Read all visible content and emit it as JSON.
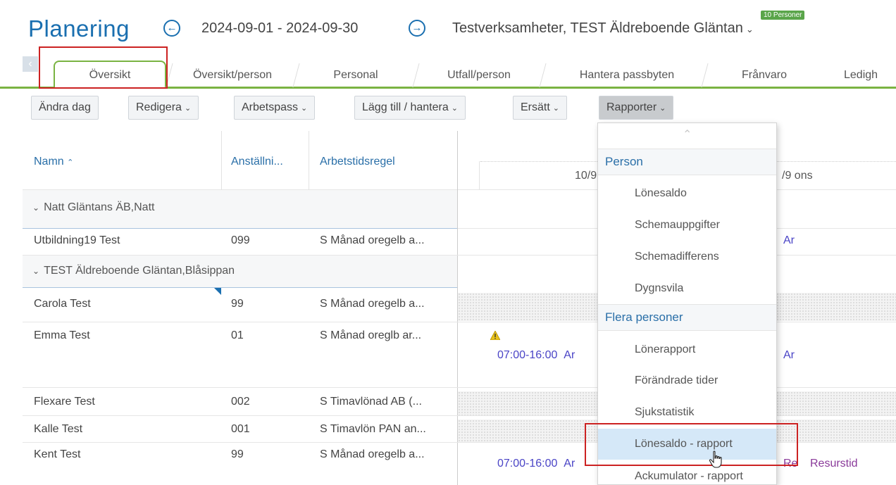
{
  "header": {
    "title": "Planering",
    "period": "2024-09-01 - 2024-09-30",
    "organization": "Testverksamheter, TEST Äldreboende Gläntan",
    "persons_badge": "10 Personer",
    "prev_icon": "circle-arrow-left-icon",
    "next_icon": "circle-arrow-right-icon"
  },
  "tabs": [
    {
      "label": "Översikt",
      "active": true
    },
    {
      "label": "Översikt/person"
    },
    {
      "label": "Personal"
    },
    {
      "label": "Utfall/person"
    },
    {
      "label": "Hantera passbyten"
    },
    {
      "label": "Frånvaro"
    },
    {
      "label": "Ledigh"
    }
  ],
  "toolbar": {
    "change_day": "Ändra dag",
    "edit": "Redigera",
    "shifts": "Arbetspass",
    "add_manage": "Lägg till / hantera",
    "replace": "Ersätt",
    "reports": "Rapporter"
  },
  "columns": {
    "name": "Namn",
    "name_sort": "^",
    "employment": "Anställni...",
    "rule": "Arbetstidsregel",
    "day1": "10/9 t",
    "day2": "/9 ons"
  },
  "groups": [
    {
      "label": "Natt Gläntans ÄB,Natt"
    },
    {
      "label": "TEST Äldreboende Gläntan,Blåsippan"
    }
  ],
  "rows": [
    {
      "name": "Utbildning19 Test",
      "emp": "099",
      "rule": "S Månad oregelb a...",
      "day2": "Ar"
    },
    {
      "name": "Carola Test",
      "emp": "99",
      "rule": "S Månad oregelb a..."
    },
    {
      "name": "Emma Test",
      "emp": "01",
      "rule": "S Månad oreglb ar...",
      "shift": "07:00-16:00",
      "shift_code": "Ar",
      "day2": "Ar"
    },
    {
      "name": "Flexare Test",
      "emp": "002",
      "rule": "S Timavlönad AB (..."
    },
    {
      "name": "Kalle Test",
      "emp": "001",
      "rule": "S Timavlön PAN an..."
    },
    {
      "name": "Kent Test",
      "emp": "99",
      "rule": "S Månad oregelb a...",
      "shift": "07:00-16:00",
      "shift_code": "Ar",
      "day2_code": "Re",
      "day2": "Resurstid"
    }
  ],
  "menu": {
    "section_person": "Person",
    "person_items": [
      "Lönesaldo",
      "Schemauppgifter",
      "Schemadifferens",
      "Dygnsvila"
    ],
    "section_multi": "Flera personer",
    "multi_items": [
      "Lönerapport",
      "Förändrade tider",
      "Sjukstatistik",
      "Lönesaldo - rapport",
      "Ackumulator - rapport"
    ],
    "hovered": "Lönesaldo - rapport"
  },
  "colors": {
    "accent": "#1a6fb0",
    "tab_green": "#7ab342",
    "highlight_red": "#cc2222",
    "shift_blue": "#4a44c6",
    "hover_blue": "#d5e8f8"
  }
}
